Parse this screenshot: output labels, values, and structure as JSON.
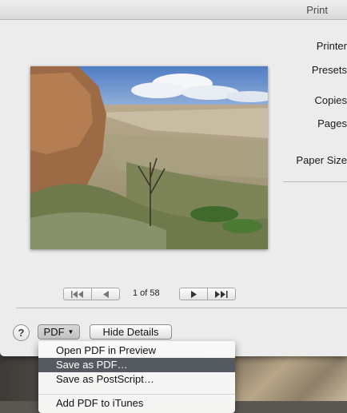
{
  "window": {
    "title": "Print"
  },
  "settings": {
    "labels": [
      "Printer",
      "Presets",
      "Copies",
      "Pages",
      "Paper Size"
    ]
  },
  "preview": {
    "page_indicator": "1 of 58"
  },
  "footer": {
    "help_label": "?",
    "pdf_label": "PDF",
    "hide_details_label": "Hide Details"
  },
  "pdf_menu": {
    "items": [
      "Open PDF in Preview",
      "Save as PDF…",
      "Save as PostScript…",
      "Add PDF to iTunes"
    ],
    "selected_index": 1
  }
}
